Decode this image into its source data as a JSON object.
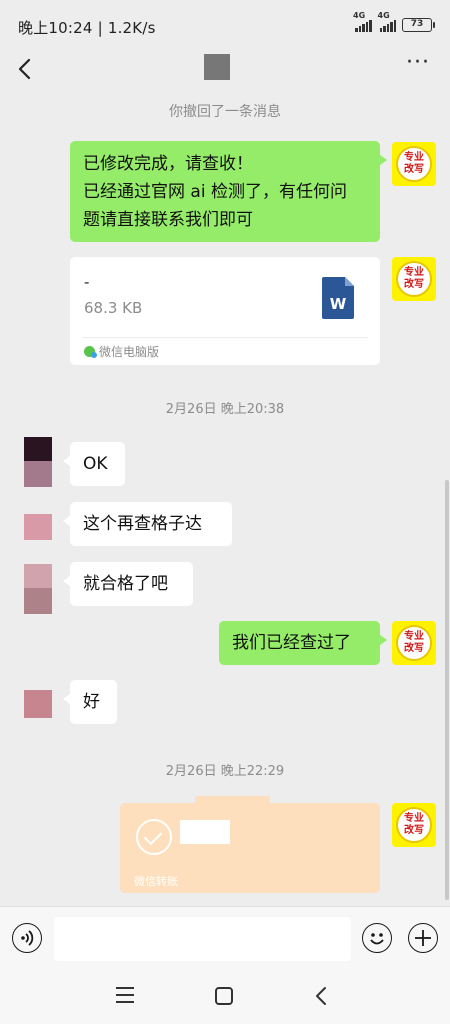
{
  "status_bar": {
    "time": "晚上10:24",
    "speed": "| 1.2K/s",
    "signal1_label": "4G",
    "signal2_label": "4G",
    "battery": "73"
  },
  "nav": {
    "back_icon": "chevron-left-icon",
    "more_label": "···"
  },
  "messages": {
    "recall_notice": "你撤回了一条消息",
    "msg1_line1": "已修改完成，请查收！",
    "msg1_line2": "已经通过官网 ai 检测了，有任何问",
    "msg1_line3": "题请直接联系我们即可",
    "file": {
      "name": "-",
      "size": "68.3 KB",
      "source": "微信电脑版",
      "icon": "word-icon",
      "icon_letter": "W"
    },
    "timestamp1": "2月26日 晚上20:38",
    "msg_ok": "OK",
    "msg_check": "这个再查格子达",
    "msg_pass": "就合格了吧",
    "msg_checked": "我们已经查过了",
    "msg_good": "好",
    "timestamp2": "2月26日 晚上22:29",
    "transfer_label": "微信转账"
  },
  "my_avatar": {
    "line1": "专业",
    "line2": "改写"
  },
  "colors": {
    "my_bubble": "#95ec69",
    "other_bubble": "#ffffff",
    "background": "#ededed",
    "transfer": "#fddfbd",
    "avatar_yellow": "#fff200"
  }
}
